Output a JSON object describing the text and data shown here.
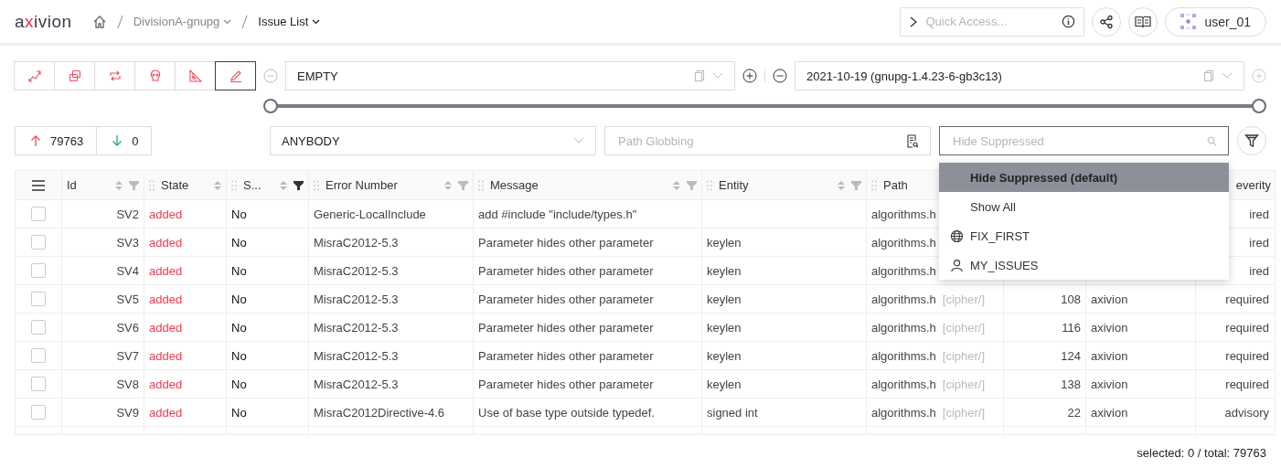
{
  "header": {
    "logo": "axivion",
    "breadcrumbs": [
      {
        "label": "DivisionA-gnupg",
        "current": false
      },
      {
        "label": "Issue List",
        "current": true
      }
    ],
    "quick_access": {
      "placeholder": "Quick Access..."
    },
    "user": "user_01"
  },
  "toolbar": {
    "buttons": [
      {
        "kind": "trend",
        "selected": false
      },
      {
        "kind": "clone",
        "selected": false
      },
      {
        "kind": "cycle",
        "selected": false
      },
      {
        "kind": "dead",
        "selected": false
      },
      {
        "kind": "metric",
        "selected": false
      },
      {
        "kind": "style",
        "selected": true
      }
    ],
    "base_version": "EMPTY",
    "current_version": "2021-10-19 (gnupg-1.4.23-6-gb3c13)",
    "add_after_disabled": true
  },
  "slider": {
    "thumbs": [
      {
        "level": 0
      },
      {
        "level": 1
      }
    ]
  },
  "counts": {
    "added": "79763",
    "removed": "0"
  },
  "user_filter": "ANYBODY",
  "path_filter": {
    "placeholder": "Path Globbing"
  },
  "suppression_filter": {
    "placeholder": "Hide Suppressed"
  },
  "dropdown": [
    {
      "label": "Hide Suppressed (default)",
      "kind": "plain",
      "selected": true
    },
    {
      "label": "Show All",
      "kind": "plain",
      "selected": false
    },
    {
      "label": "FIX_FIRST",
      "kind": "global",
      "selected": false
    },
    {
      "label": "MY_ISSUES",
      "kind": "user",
      "selected": false
    }
  ],
  "table": {
    "columns": [
      {
        "label": "Id",
        "draggable": false,
        "filterable": true,
        "filter_active": false
      },
      {
        "label": "State",
        "draggable": true,
        "filterable": false
      },
      {
        "label": "S...",
        "draggable": true,
        "filterable": true,
        "filter_active": true
      },
      {
        "label": "Error Number",
        "draggable": true,
        "filterable": true,
        "filter_active": false
      },
      {
        "label": "Message",
        "draggable": true,
        "filterable": true,
        "filter_active": false
      },
      {
        "label": "Entity",
        "draggable": true,
        "filterable": true,
        "filter_active": false
      },
      {
        "label": "Path",
        "draggable": true,
        "filterable": false
      },
      {
        "label": "everity",
        "draggable": false,
        "filterable": false
      }
    ],
    "rows": [
      {
        "checked": false,
        "id": "SV2",
        "state": "added",
        "suppressed": "No",
        "error_number": "Generic-LocalInclude",
        "message": "add #include \"include/types.h\"",
        "path_file": "algorithms.h",
        "severity": "ired"
      },
      {
        "checked": false,
        "id": "SV3",
        "state": "added",
        "suppressed": "No",
        "error_number": "MisraC2012-5.3",
        "message": "Parameter hides other parameter",
        "entity": "keylen",
        "path_file": "algorithms.h",
        "severity": "ired"
      },
      {
        "checked": false,
        "id": "SV4",
        "state": "added",
        "suppressed": "No",
        "error_number": "MisraC2012-5.3",
        "message": "Parameter hides other parameter",
        "entity": "keylen",
        "path_file": "algorithms.h",
        "severity": "ired"
      },
      {
        "checked": false,
        "id": "SV5",
        "state": "added",
        "suppressed": "No",
        "error_number": "MisraC2012-5.3",
        "message": "Parameter hides other parameter",
        "entity": "keylen",
        "path_file": "algorithms.h",
        "path_dir": "[cipher/]",
        "line": "108",
        "provider": "axivion",
        "severity": "required"
      },
      {
        "checked": false,
        "id": "SV6",
        "state": "added",
        "suppressed": "No",
        "error_number": "MisraC2012-5.3",
        "message": "Parameter hides other parameter",
        "entity": "keylen",
        "path_file": "algorithms.h",
        "path_dir": "[cipher/]",
        "line": "116",
        "provider": "axivion",
        "severity": "required"
      },
      {
        "checked": false,
        "id": "SV7",
        "state": "added",
        "suppressed": "No",
        "error_number": "MisraC2012-5.3",
        "message": "Parameter hides other parameter",
        "entity": "keylen",
        "path_file": "algorithms.h",
        "path_dir": "[cipher/]",
        "line": "124",
        "provider": "axivion",
        "severity": "required"
      },
      {
        "checked": false,
        "id": "SV8",
        "state": "added",
        "suppressed": "No",
        "error_number": "MisraC2012-5.3",
        "message": "Parameter hides other parameter",
        "entity": "keylen",
        "path_file": "algorithms.h",
        "path_dir": "[cipher/]",
        "line": "138",
        "provider": "axivion",
        "severity": "required"
      },
      {
        "checked": false,
        "id": "SV9",
        "state": "added",
        "suppressed": "No",
        "error_number": "MisraC2012Directive-4.6",
        "message": "Use of base type outside typedef.",
        "entity": "signed int",
        "path_file": "algorithms.h",
        "path_dir": "[cipher/]",
        "line": "22",
        "provider": "axivion",
        "severity": "advisory"
      }
    ]
  },
  "status": "selected: 0 / total: 79763"
}
